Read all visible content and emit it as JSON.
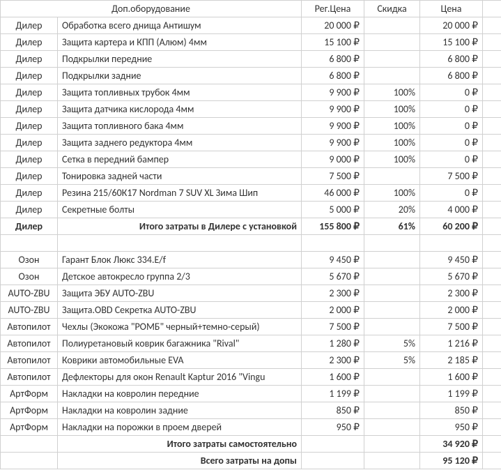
{
  "headers": {
    "col1": "Доп.оборудование",
    "col3": "Рег.Цена",
    "col4": "Скидка",
    "col5": "Цена"
  },
  "dealerLabel": "Дилер",
  "dealerRows": [
    {
      "name": "Обработка всего днища Антишум",
      "reg": "20 000 ₽",
      "disc": "",
      "price": "20 000 ₽"
    },
    {
      "name": "Защита картера и КПП (Алюм) 4мм",
      "reg": "15 100 ₽",
      "disc": "",
      "price": "15 100 ₽"
    },
    {
      "name": "Подкрылки передние",
      "reg": "6 800 ₽",
      "disc": "",
      "price": "6 800 ₽"
    },
    {
      "name": "Подкрылки задние",
      "reg": "6 800 ₽",
      "disc": "",
      "price": "6 800 ₽"
    },
    {
      "name": "Защита топливных трубок 4мм",
      "reg": "9 900 ₽",
      "disc": "100%",
      "price": "0 ₽"
    },
    {
      "name": "Защита датчика кислорода 4мм",
      "reg": "9 900 ₽",
      "disc": "100%",
      "price": "0 ₽"
    },
    {
      "name": "Защита топливного бака 4мм",
      "reg": "9 900 ₽",
      "disc": "100%",
      "price": "0 ₽"
    },
    {
      "name": "Защита заднего редуктора 4мм",
      "reg": "9 900 ₽",
      "disc": "100%",
      "price": "0 ₽"
    },
    {
      "name": "Сетка в передний бампер",
      "reg": "9 000 ₽",
      "disc": "100%",
      "price": "0 ₽"
    },
    {
      "name": "Тонировка задней части",
      "reg": "7 500 ₽",
      "disc": "",
      "price": "7 500 ₽"
    },
    {
      "name": "Резина 215/60К17 Nordman 7 SUV  XL Зима Шип",
      "reg": "46 000 ₽",
      "disc": "100%",
      "price": "0 ₽"
    },
    {
      "name": "Секретные болты",
      "reg": "5 000 ₽",
      "disc": "20%",
      "price": "4 000 ₽"
    }
  ],
  "dealerTotal": {
    "src": "Дилер",
    "name": "Итого затраты в Дилере с установкой",
    "reg": "155 800 ₽",
    "disc": "61%",
    "price": "60 200 ₽"
  },
  "otherRows": [
    {
      "src": "Озон",
      "name": "Гарант Блок Люкс 334.E/f",
      "reg": "9 450 ₽",
      "disc": "",
      "price": "9 450 ₽"
    },
    {
      "src": "Озон",
      "name": "Детское автокресло группа 2/3",
      "reg": "5 670 ₽",
      "disc": "",
      "price": "5 670 ₽"
    },
    {
      "src": "AUTO-ZBU",
      "name": "Защита ЭБУ AUTO-ZBU",
      "reg": "2 300 ₽",
      "disc": "",
      "price": "2 300 ₽"
    },
    {
      "src": "AUTO-ZBU",
      "name": "Защита.OBD Секретка AUTO-ZBU",
      "reg": "2 000 ₽",
      "disc": "",
      "price": "2 000 ₽"
    },
    {
      "src": "Автопилот",
      "name": "Чехлы  (Экокожа \"РОМБ\" черный+темно-серый)",
      "reg": "7 500 ₽",
      "disc": "",
      "price": "7 500 ₽"
    },
    {
      "src": "Автопилот",
      "name": "Полиуретановый коврик багажника \"Rival\"",
      "reg": "1 280 ₽",
      "disc": "5%",
      "price": "1 216 ₽"
    },
    {
      "src": "Автопилот",
      "name": "Коврики автомобильные EVA",
      "reg": "2 300 ₽",
      "disc": "5%",
      "price": "2 185 ₽"
    },
    {
      "src": "Автопилот",
      "name": "Дефлекторы для окон Renault Kaptur 2016 \"Vingu",
      "reg": "1 600 ₽",
      "disc": "",
      "price": "1 600 ₽"
    },
    {
      "src": "АртФорм",
      "name": "Накладки на ковролин передние",
      "reg": "1 199 ₽",
      "disc": "",
      "price": "1 199 ₽"
    },
    {
      "src": "АртФорм",
      "name": "Накладки на ковролин задние",
      "reg": "850 ₽",
      "disc": "",
      "price": "850 ₽"
    },
    {
      "src": "АртФорм",
      "name": "Накладки на порожки в проем дверей",
      "reg": "950 ₽",
      "disc": "",
      "price": "950 ₽"
    }
  ],
  "selfTotal": {
    "name": "Итого затраты самостоятельно",
    "price": "34 920 ₽"
  },
  "grandTotal": {
    "name": "Всего затраты на допы",
    "price": "95 120 ₽"
  }
}
